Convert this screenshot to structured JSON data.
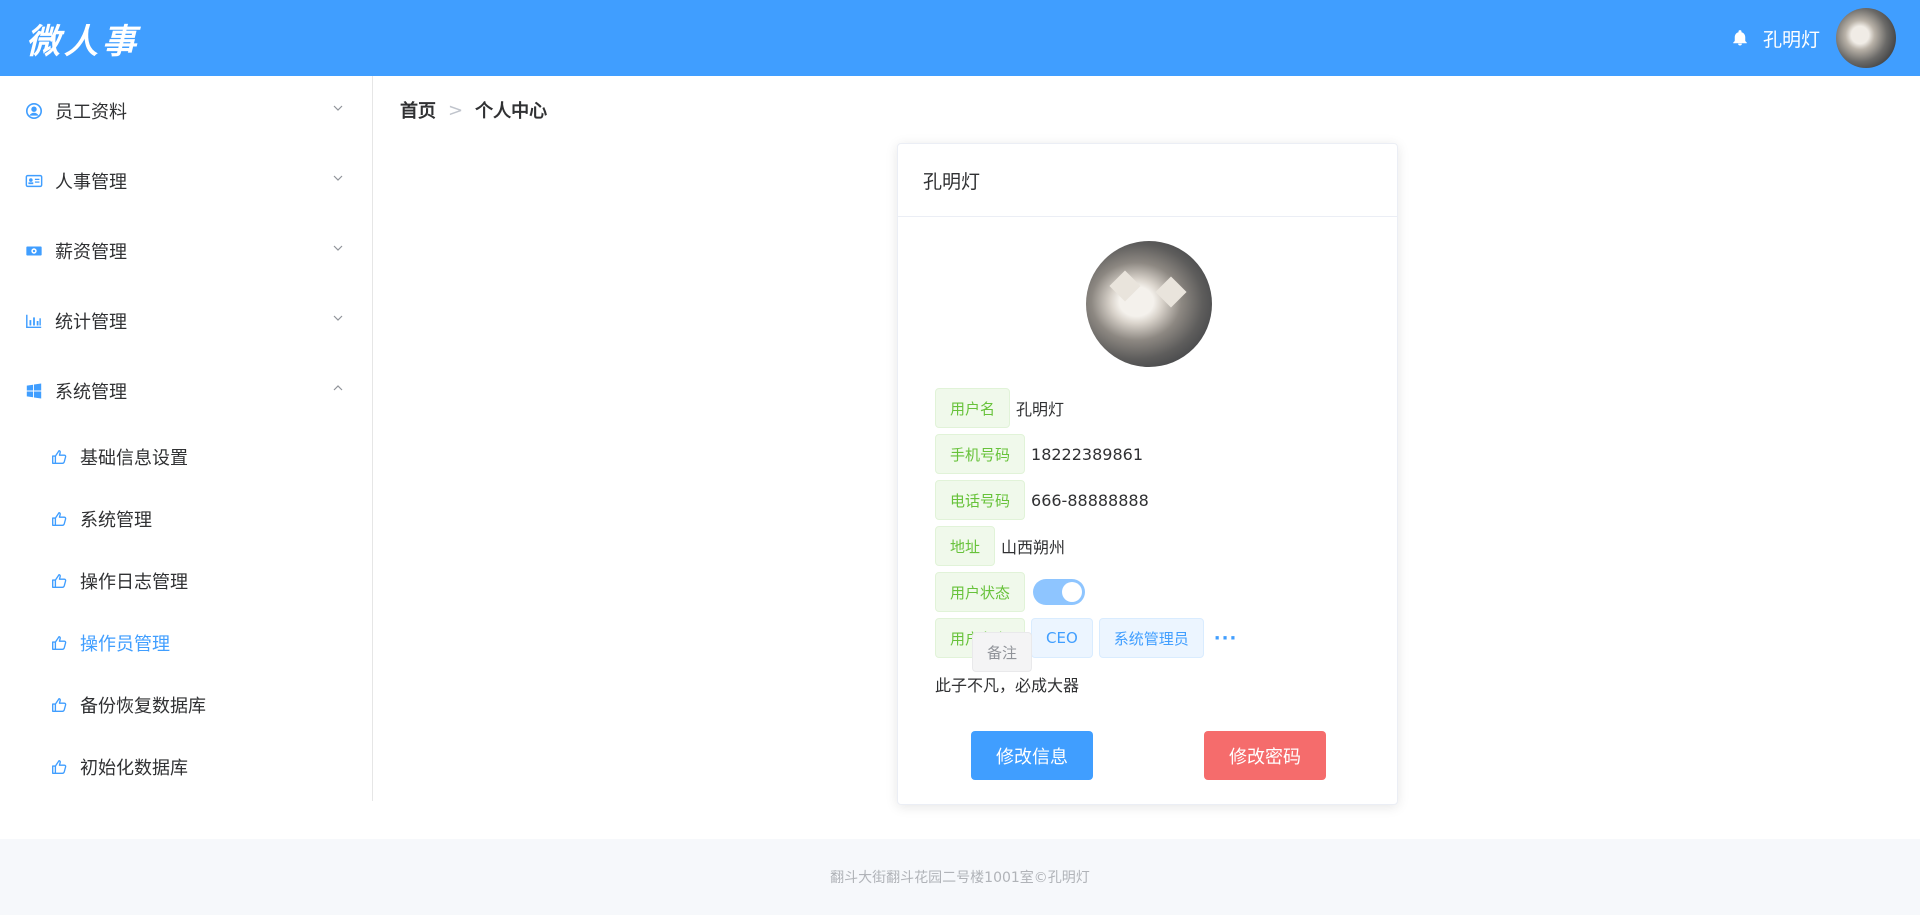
{
  "header": {
    "logo": "微人事",
    "username": "孔明灯",
    "bell_icon": "bell-icon",
    "brand_color": "#409eff"
  },
  "sidebar": {
    "menus": [
      {
        "label": "员工资料",
        "icon": "user-circle-icon",
        "expanded": false
      },
      {
        "label": "人事管理",
        "icon": "id-card-icon",
        "expanded": false
      },
      {
        "label": "薪资管理",
        "icon": "money-icon",
        "expanded": false
      },
      {
        "label": "统计管理",
        "icon": "bar-chart-icon",
        "expanded": false
      },
      {
        "label": "系统管理",
        "icon": "windows-icon",
        "expanded": true
      }
    ],
    "submenu": [
      {
        "label": "基础信息设置",
        "active": false
      },
      {
        "label": "系统管理",
        "active": false
      },
      {
        "label": "操作日志管理",
        "active": false
      },
      {
        "label": "操作员管理",
        "active": true
      },
      {
        "label": "备份恢复数据库",
        "active": false
      },
      {
        "label": "初始化数据库",
        "active": false
      }
    ]
  },
  "breadcrumb": {
    "home": "首页",
    "current": "个人中心",
    "separator": ">"
  },
  "profile": {
    "title": "孔明灯",
    "fields": {
      "username": {
        "label": "用户名",
        "value": "孔明灯"
      },
      "mobile": {
        "label": "手机号码",
        "value": "18222389861"
      },
      "phone": {
        "label": "电话号码",
        "value": "666-88888888"
      },
      "address": {
        "label": "地址",
        "value": "山西朔州"
      },
      "status": {
        "label": "用户状态",
        "enabled": true
      },
      "roles": {
        "label": "用户角色",
        "values": [
          "CEO",
          "系统管理员"
        ],
        "more": "···"
      },
      "remark": {
        "label": "备注",
        "value": "此子不凡，必成大器"
      }
    },
    "buttons": {
      "edit_info": "修改信息",
      "change_password": "修改密码"
    }
  },
  "footer": {
    "text": "翻斗大街翻斗花园二号楼1001室©孔明灯"
  }
}
